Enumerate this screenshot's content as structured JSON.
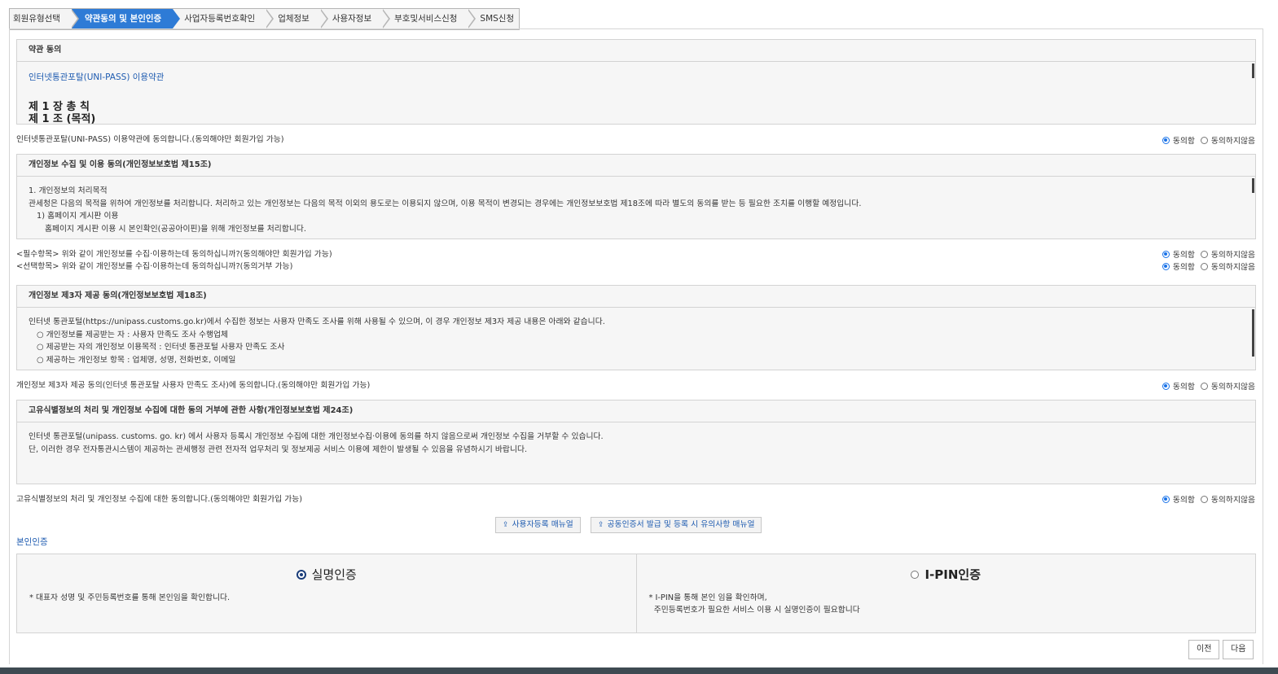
{
  "steps": [
    {
      "label": "회원유형선택",
      "active": false
    },
    {
      "label": "약관동의 및 본인인증",
      "active": true
    },
    {
      "label": "사업자등록번호확인",
      "active": false
    },
    {
      "label": "업체정보",
      "active": false
    },
    {
      "label": "사용자정보",
      "active": false
    },
    {
      "label": "부호및서비스신청",
      "active": false
    },
    {
      "label": "SMS신청",
      "active": false
    }
  ],
  "terms": {
    "header": "약관 동의",
    "link": "인터넷통관포탈(UNI-PASS) 이용약관",
    "chapter": "제 1 장 총 칙",
    "article": "제 1 조 (목적)",
    "agree_text": "인터넷통관포탈(UNI-PASS) 이용약관에 동의합니다.(동의해야만 회원가입 가능)"
  },
  "radio": {
    "agree": "동의함",
    "disagree": "동의하지않음"
  },
  "privacy": {
    "header": "개인정보 수집 및 이용 동의(개인정보보호법 제15조)",
    "lines": [
      "1. 개인정보의 처리목적",
      "관세청은 다음의 목적을 위하여 개인정보를 처리합니다. 처리하고 있는 개인정보는 다음의 목적 이외의 용도로는 이용되지 않으며, 이용 목적이 변경되는 경우에는 개인정보보호법 제18조에 따라 별도의 동의를 받는 등 필요한 조치를 이행할 예정입니다.",
      "  1) 홈페이지 게시판 이용",
      "     홈페이지 게시판 이용 시 본인확인(공공아이핀)을 위해 개인정보를 처리합니다."
    ],
    "required_text": "<필수항목> 위와 같이 개인정보를 수집·이용하는데 동의하십니까?(동의해야만 회원가입 가능)",
    "optional_text": "<선택항목> 위와 같이 개인정보를 수집·이용하는데 동의하십니까?(동의거부 가능)"
  },
  "third_party": {
    "header": "개인정보 제3자 제공 동의(개인정보보호법 제18조)",
    "lines": [
      "인터넷 통관포털(https://unipass.customs.go.kr)에서 수집한 정보는 사용자 만족도 조사를 위해 사용될 수 있으며, 이 경우 개인정보 제3자 제공 내용은 아래와 같습니다.",
      "  ○ 개인정보를 제공받는 자 : 사용자 만족도 조사 수행업체",
      "  ○ 제공받는 자의 개인정보 이용목적 : 인터넷 통관포털 사용자 만족도 조사",
      "  ○ 제공하는 개인정보 항목 : 업체명, 성명, 전화번호, 이메일"
    ],
    "agree_text": "개인정보 제3자 제공 동의(인터넷 통관포탈 사용자 만족도 조사)에 동의합니다.(동의해야만 회원가입 가능)"
  },
  "unique_id": {
    "header": "고유식별정보의 처리 및 개인정보 수집에 대한 동의 거부에 관한 사항(개인정보보호법 제24조)",
    "lines": [
      "인터넷 통관포털(unipass. customs. go. kr) 에서 사용자 등록시 개인정보 수집에 대한 개인정보수집·이용에 동의를 하지 않음으로써 개인정보 수집을 거부할 수 있습니다.",
      "단, 이러한 경우 전자통관시스템이 제공하는 관세행정 관련 전자적 업무처리 및 정보제공 서비스 이용에 제한이 발생될 수 있음을 유념하시기 바랍니다."
    ],
    "agree_text": "고유식별정보의 처리 및 개인정보 수집에 대한 동의합니다.(동의해야만 회원가입 가능)"
  },
  "manuals": {
    "user_manual": "사용자등록 매뉴얼",
    "cert_manual": "공동인증서 발급 및 등록 시 유의사항 매뉴얼"
  },
  "auth": {
    "section_title": "본인인증",
    "real_name": {
      "title": "실명인증",
      "desc": "* 대표자 성명 및 주민등록번호를 통해 본인임을 확인합니다.",
      "selected": true
    },
    "ipin": {
      "title": "I-PIN인증",
      "desc1": "* I-PIN을 통해 본인 임을 확인하며,",
      "desc2": "  주민등록번호가 필요한 서비스 이용 시 실명인증이 필요합니다",
      "selected": false
    }
  },
  "nav": {
    "prev": "이전",
    "next": "다음"
  }
}
